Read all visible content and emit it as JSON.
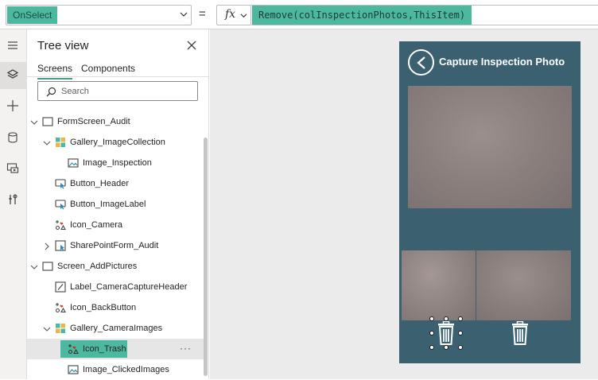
{
  "formula_bar": {
    "property": "OnSelect",
    "equals": "=",
    "fx_label": "fx",
    "formula": "Remove(colInspectionPhotos,ThisItem)"
  },
  "rail": {
    "items": [
      "hamburger-menu-icon",
      "layers-icon",
      "plus-icon",
      "database-icon",
      "media-icon",
      "tools-icon"
    ]
  },
  "tree": {
    "title": "Tree view",
    "tabs": [
      {
        "label": "Screens",
        "active": true
      },
      {
        "label": "Components",
        "active": false
      }
    ],
    "search_placeholder": "Search",
    "rows": [
      {
        "label": "FormScreen_Audit",
        "icon": "screen-icon",
        "expand": "expanded"
      },
      {
        "label": "Gallery_ImageCollection",
        "icon": "gallery-icon",
        "expand": "expanded"
      },
      {
        "label": "Image_Inspection",
        "icon": "image-icon",
        "expand": "none"
      },
      {
        "label": "Button_Header",
        "icon": "button-icon",
        "expand": "none"
      },
      {
        "label": "Button_ImageLabel",
        "icon": "button-icon",
        "expand": "none"
      },
      {
        "label": "Icon_Camera",
        "icon": "icon-control-icon",
        "expand": "none"
      },
      {
        "label": "SharePointForm_Audit",
        "icon": "form-icon",
        "expand": "collapsed"
      },
      {
        "label": "Screen_AddPictures",
        "icon": "screen-icon",
        "expand": "expanded"
      },
      {
        "label": "Label_CameraCaptureHeader",
        "icon": "label-icon",
        "expand": "none"
      },
      {
        "label": "Icon_BackButton",
        "icon": "icon-control-icon",
        "expand": "none"
      },
      {
        "label": "Gallery_CameraImages",
        "icon": "gallery-icon",
        "expand": "expanded"
      },
      {
        "label": "Icon_Trash",
        "icon": "icon-control-icon",
        "expand": "none",
        "selected": true
      },
      {
        "label": "Image_ClickedImages",
        "icon": "image-icon",
        "expand": "none"
      }
    ],
    "more_label": "···"
  },
  "app": {
    "title": "Capture Inspection Photo",
    "background": "#3b6070",
    "accent": "#4db8a0"
  }
}
